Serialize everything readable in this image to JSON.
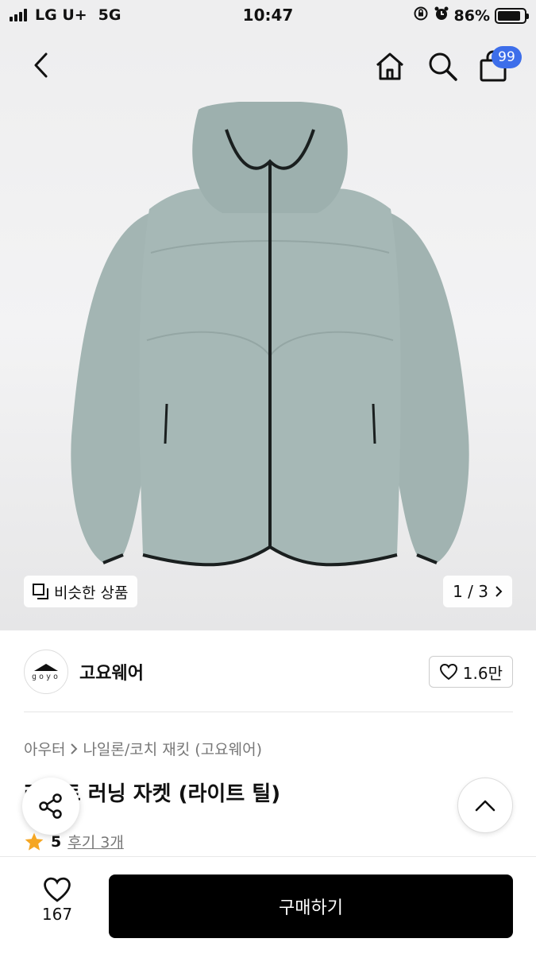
{
  "status_bar": {
    "carrier": "LG U+",
    "network": "5G",
    "time": "10:47",
    "battery": "86%",
    "battery_level": 0.86,
    "icons": [
      "signal-icon",
      "orientation-lock-icon",
      "alarm-icon",
      "battery-icon"
    ]
  },
  "header": {
    "back_icon": "chevron-left-icon",
    "home_icon": "home-icon",
    "search_icon": "search-icon",
    "cart_icon": "shopping-bag-icon",
    "cart_badge": "99",
    "badge_color": "#3d6eea"
  },
  "gallery": {
    "similar_label": "비슷한 상품",
    "pager": "1 / 3",
    "jacket_color": "#a2b5b2"
  },
  "shop": {
    "logo_text": "goyo",
    "name": "고요웨어",
    "likes": "1.6만"
  },
  "product": {
    "breadcrumb": [
      "아우터",
      "나일론/코치 재킷 (고요웨어)"
    ],
    "title": "라이트 러닝 자켓 (라이트 틸)",
    "rating": "5",
    "reviews": "후기 3개",
    "star_color": "#f5a623"
  },
  "bottom_bar": {
    "wish_count": "167",
    "buy_label": "구매하기"
  }
}
